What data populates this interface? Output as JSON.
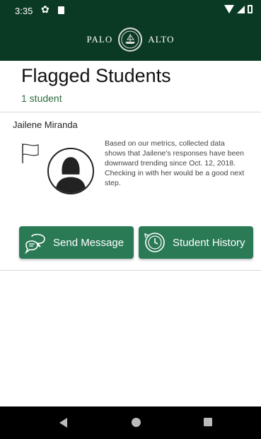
{
  "status_bar": {
    "time": "3:35"
  },
  "header": {
    "brand_left": "PALO",
    "brand_right": "ALTO"
  },
  "page": {
    "title": "Flagged Students",
    "count_label": "1 student"
  },
  "students": [
    {
      "name": "Jailene Miranda",
      "note": "Based on our metrics, collected data shows that Jailene's responses have been downward trending since Oct. 12, 2018.  Checking in with her would be a good next step."
    }
  ],
  "actions": {
    "send_message": "Send Message",
    "student_history": "Student History"
  },
  "icons": {
    "status": [
      "settings-gear-icon",
      "sd-card-icon",
      "wifi-icon",
      "signal-icon",
      "battery-icon"
    ],
    "card": [
      "flag-icon",
      "avatar-silhouette"
    ],
    "buttons": [
      "chat-bubbles-icon",
      "history-clock-icon"
    ],
    "nav": [
      "back-icon",
      "home-icon",
      "recents-icon"
    ]
  },
  "colors": {
    "header": "#0a3a24",
    "accent": "#2a7a56",
    "subtitle": "#2d6b3f"
  }
}
